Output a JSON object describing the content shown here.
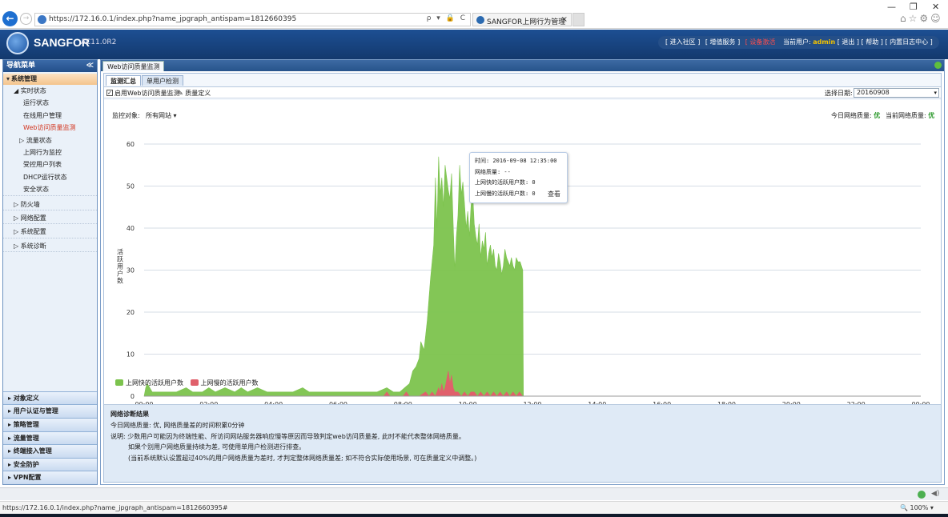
{
  "browser": {
    "url": "https://172.16.0.1/index.php?name_jpgraph_antispam=1812660395",
    "url_tools": "ρ ▾ 🔒 C",
    "tab_title": "SANGFOR上网行为管理",
    "tab_close": "×",
    "back": "←",
    "forward": "→",
    "win_min": "—",
    "win_max": "❐",
    "win_close": "✕",
    "tools": "⌂☆⚙☺",
    "status_url": "https://172.16.0.1/index.php?name_jpgraph_antispam=1812660395#",
    "zoom": "🔍 100%  ▾"
  },
  "header": {
    "logo": "SANGFOR",
    "version": "AC11.0R2",
    "links": [
      "[ 进入社区 ]",
      "[ 增值服务 ]",
      "[ 设备激活 ]"
    ],
    "user_label": "当前用户:",
    "user_name": "admin",
    "user_links": "[ 退出 ] [ 帮助 ] [ 内置日志中心 ]"
  },
  "sidebar": {
    "title": "导航菜单",
    "collapse": "≪",
    "section": "系统管理",
    "section_tri": "▾",
    "items": [
      {
        "label": "◢ 实时状态"
      },
      {
        "label": "运行状态"
      },
      {
        "label": "在线用户管理"
      },
      {
        "label": "Web访问质量监测"
      },
      {
        "label": "▷ 流量状态"
      },
      {
        "label": "上网行为监控"
      },
      {
        "label": "受控用户列表"
      },
      {
        "label": "DHCP运行状态"
      },
      {
        "label": "安全状态"
      },
      {
        "label": "▷ 防火墙"
      },
      {
        "label": "▷ 网络配置"
      },
      {
        "label": "▷ 系统配置"
      },
      {
        "label": "▷ 系统诊断"
      }
    ],
    "bottom": [
      "▸ 对象定义",
      "▸ 用户认证与管理",
      "▸ 策略管理",
      "▸ 流量管理",
      "▸ 终端接入管理",
      "▸ 安全防护",
      "▸ VPN配置"
    ]
  },
  "main": {
    "tab": "Web访问质量监测",
    "subtabs": [
      "监测汇总",
      "单用户检测"
    ],
    "enable_label": "启用Web访问质量监测",
    "enable_check": "✓",
    "quality_def": "✎ 质量定义",
    "date_label": "选择日期:",
    "date_value": "20160908",
    "date_arrow": "▾",
    "monitor_label": "监控对象:",
    "monitor_value": "所有网站 ▾",
    "today_label": "今日网络质量:",
    "today_value": "优",
    "now_label": "当前网络质量:",
    "now_value": "优"
  },
  "colors": {
    "good": "#7cc34d",
    "slow": "#e0606b",
    "accent": "#1d4f93"
  },
  "chart_data": {
    "type": "area",
    "ylabel": "活跃用户数",
    "xlabel": "",
    "ylim": [
      0,
      60
    ],
    "yticks": [
      0,
      10,
      20,
      30,
      40,
      50,
      60
    ],
    "xticks": [
      "00:00",
      "02:00",
      "04:00",
      "06:00",
      "08:00",
      "10:00",
      "12:00",
      "14:00",
      "16:00",
      "18:00",
      "20:00",
      "22:00",
      "00:00"
    ],
    "xlim": [
      0,
      24
    ],
    "series": [
      {
        "name": "上网快的活跃用户数",
        "color": "#7cc34d",
        "x": [
          0,
          0.05,
          0.1,
          0.25,
          0.3,
          0.6,
          1,
          1.3,
          1.5,
          1.8,
          2,
          2.2,
          2.5,
          2.8,
          3,
          3.2,
          3.5,
          3.8,
          4,
          4.3,
          4.6,
          4.9,
          5.1,
          5.4,
          5.7,
          6,
          6.3,
          6.6,
          6.9,
          7.2,
          7.5,
          7.7,
          7.9,
          8.05,
          8.2,
          8.3,
          8.4,
          8.5,
          8.55,
          8.65,
          8.75,
          8.85,
          8.95,
          9.0,
          9.05,
          9.1,
          9.15,
          9.2,
          9.25,
          9.3,
          9.35,
          9.4,
          9.45,
          9.5,
          9.55,
          9.6,
          9.65,
          9.7,
          9.75,
          9.8,
          9.85,
          9.9,
          9.95,
          10.0,
          10.05,
          10.1,
          10.15,
          10.2,
          10.25,
          10.3,
          10.35,
          10.4,
          10.45,
          10.5,
          10.55,
          10.6,
          10.65,
          10.7,
          10.75,
          10.8,
          10.85,
          10.9,
          10.95,
          11.0,
          11.05,
          11.1,
          11.15,
          11.2,
          11.25,
          11.3,
          11.35,
          11.4,
          11.45,
          11.5,
          11.55,
          11.62,
          11.7,
          11.72,
          24
        ],
        "values": [
          0,
          2,
          3,
          1,
          1,
          1,
          1,
          2,
          1,
          1,
          2,
          1,
          2,
          1,
          2,
          1,
          2,
          1,
          1,
          1,
          1,
          2,
          1,
          1,
          1,
          1,
          1,
          1,
          1,
          1,
          2,
          1,
          1,
          2,
          3,
          6,
          7,
          9,
          13,
          11,
          18,
          28,
          36,
          52,
          40,
          57,
          48,
          52,
          45,
          55,
          52,
          49,
          47,
          53,
          41,
          30,
          38,
          43,
          55,
          48,
          51,
          46,
          40,
          44,
          38,
          45,
          49,
          41,
          38,
          36,
          41,
          33,
          37,
          35,
          39,
          31,
          34,
          36,
          33,
          35,
          31,
          30,
          34,
          32,
          29,
          31,
          35,
          33,
          32,
          31,
          33,
          31,
          30,
          33,
          32,
          32,
          30,
          0,
          0
        ]
      },
      {
        "name": "上网慢的活跃用户数",
        "color": "#e0606b",
        "x": [
          0,
          7.4,
          7.5,
          7.6,
          8.0,
          8.1,
          8.2,
          8.5,
          8.7,
          8.8,
          8.9,
          9.0,
          9.1,
          9.15,
          9.2,
          9.25,
          9.3,
          9.35,
          9.4,
          9.45,
          9.5,
          9.55,
          9.6,
          9.7,
          9.8,
          9.9,
          10.0,
          10.1,
          10.2,
          10.3,
          10.4,
          10.5,
          10.6,
          10.7,
          10.8,
          10.9,
          11.0,
          11.1,
          11.2,
          11.3,
          11.4,
          11.5,
          11.6,
          11.7,
          24
        ],
        "values": [
          0,
          0,
          1,
          0,
          0,
          1,
          0,
          0,
          1,
          0,
          1,
          0,
          2,
          1,
          3,
          1,
          2,
          4,
          6,
          3,
          5,
          2,
          1,
          1,
          0,
          1,
          0,
          1,
          1,
          0,
          1,
          0,
          1,
          0,
          1,
          0,
          1,
          0,
          1,
          0,
          1,
          0,
          1,
          0,
          0
        ]
      }
    ],
    "tooltip": {
      "lines": [
        "时间: 2016-09-08 12:35:00",
        "网络质量: --",
        "上网快的活跃用户数: 0",
        "上网慢的活跃用户数: 0"
      ],
      "action": "查看"
    },
    "grid": true,
    "legend": "bottom-left"
  },
  "diagnosis": {
    "title": "网络诊断结果",
    "lines": [
      "今日网络质量: 优, 网络质量差的时间积累0分钟",
      "说明: 少数用户可能因为终端性能、所访问网站服务器响应慢等原因而导致判定web访问质量差, 此时不能代表整体网络质量。",
      "如果个别用户网络质量持续为差, 可使用单用户检测进行排查。",
      "(当前系统默认设置超过40%的用户网络质量为差时, 才判定整体网络质量差; 如不符合实际使用场景, 可在质量定义中调整。)"
    ]
  }
}
